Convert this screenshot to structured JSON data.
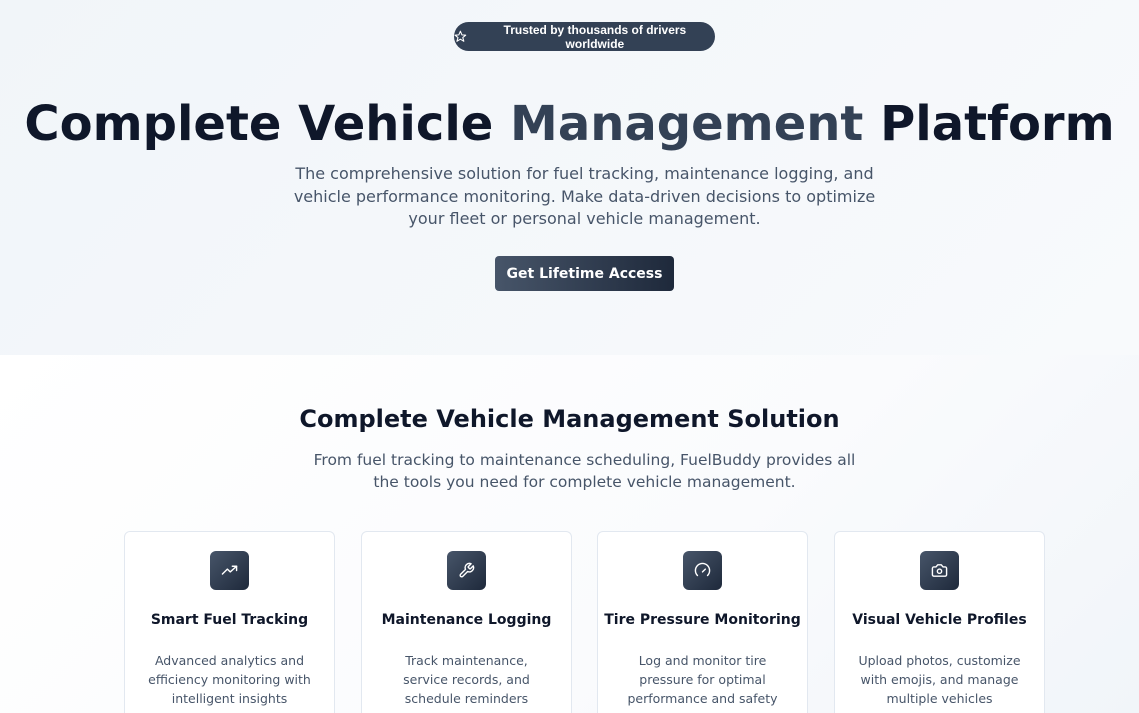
{
  "hero": {
    "badge_icon": "star-icon",
    "badge_text": "Trusted by thousands of drivers worldwide",
    "title_part1": "Complete Vehicle ",
    "title_part2": "Management",
    "title_part3": " Platform",
    "subtitle": "The comprehensive solution for fuel tracking, maintenance logging, and vehicle performance monitoring. Make data-driven decisions to optimize your fleet or personal vehicle management.",
    "cta_label": "Get Lifetime Access"
  },
  "features": {
    "title": "Complete Vehicle Management Solution",
    "subtitle": "From fuel tracking to maintenance scheduling, FuelBuddy provides all the tools you need for complete vehicle management.",
    "cards": [
      {
        "icon": "trending-up-icon",
        "title": "Smart Fuel Tracking",
        "description": "Advanced analytics and efficiency monitoring with intelligent insights"
      },
      {
        "icon": "wrench-icon",
        "title": "Maintenance Logging",
        "description": "Track maintenance, service records, and schedule reminders"
      },
      {
        "icon": "gauge-icon",
        "title": "Tire Pressure Monitoring",
        "description": "Log and monitor tire pressure for optimal performance and safety"
      },
      {
        "icon": "camera-icon",
        "title": "Visual Vehicle Profiles",
        "description": "Upload photos, customize with emojis, and manage multiple vehicles"
      }
    ]
  },
  "colors": {
    "primary_dark": "#0f172a",
    "accent_slate": "#334155",
    "text_muted": "#475569"
  }
}
